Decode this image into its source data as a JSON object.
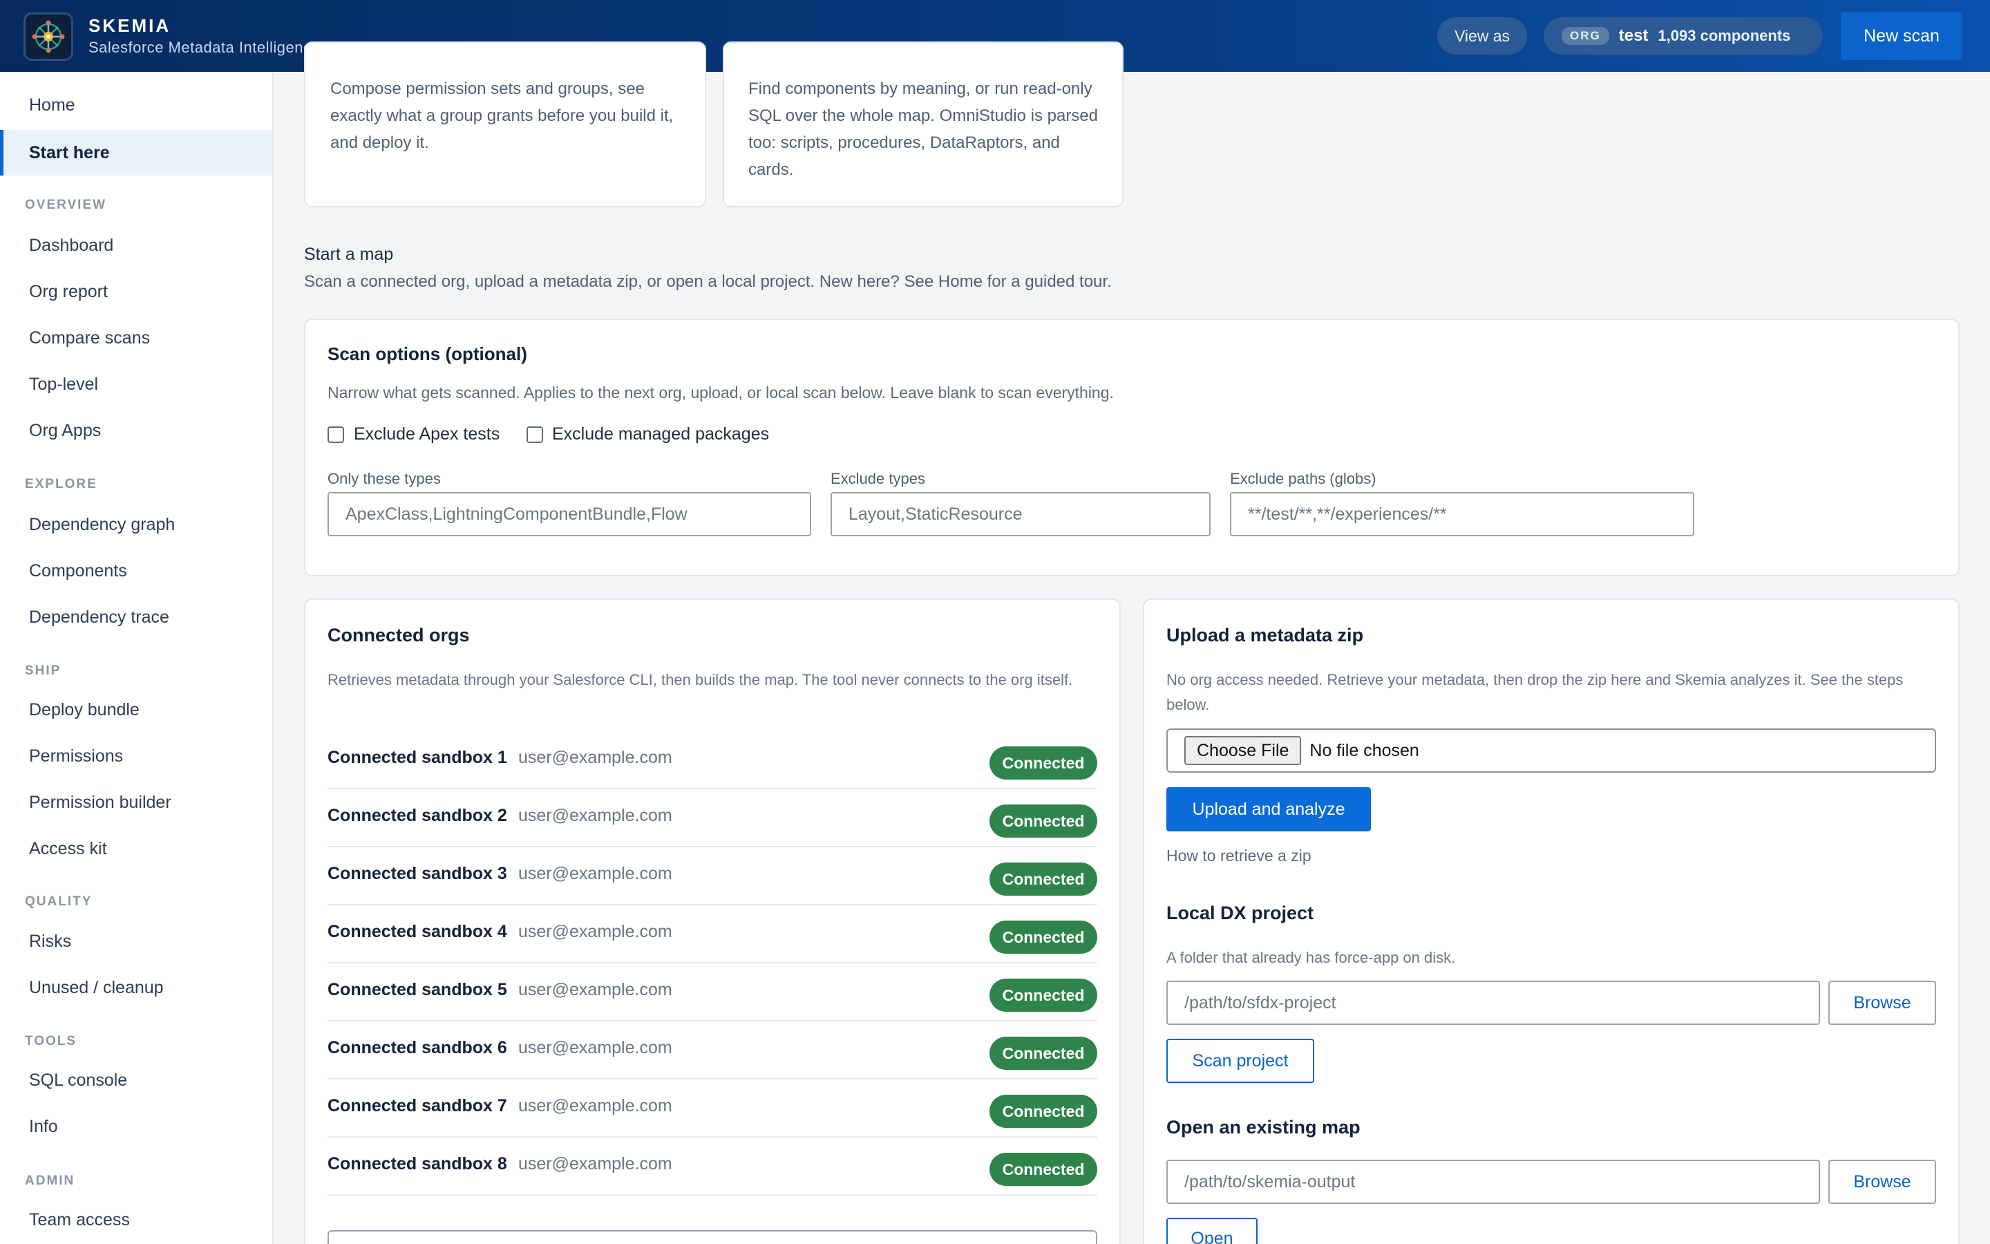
{
  "app": {
    "name": "SKEMIA",
    "tagline": "Salesforce Metadata Intelligence",
    "logo_icon": "network-compass-icon"
  },
  "header": {
    "view_as_label": "View as",
    "org_badge": "ORG",
    "org_name": "test",
    "component_count": "1,093 components",
    "new_scan_label": "New scan"
  },
  "sidebar": {
    "top_items": [
      {
        "label": "Home"
      },
      {
        "label": "Start here",
        "active": true
      }
    ],
    "sections": [
      {
        "title": "OVERVIEW",
        "items": [
          "Dashboard",
          "Org report",
          "Compare scans",
          "Top-level",
          "Org Apps"
        ]
      },
      {
        "title": "EXPLORE",
        "items": [
          "Dependency graph",
          "Components",
          "Dependency trace"
        ]
      },
      {
        "title": "SHIP",
        "items": [
          "Deploy bundle",
          "Permissions",
          "Permission builder",
          "Access kit"
        ]
      },
      {
        "title": "QUALITY",
        "items": [
          "Risks",
          "Unused / cleanup"
        ]
      },
      {
        "title": "TOOLS",
        "items": [
          "SQL console",
          "Info"
        ]
      },
      {
        "title": "ADMIN",
        "items": [
          "Team access"
        ]
      }
    ]
  },
  "features": [
    {
      "text": "Compose permission sets and groups, see exactly what a group grants before you build it, and deploy it."
    },
    {
      "text": "Find components by meaning, or run read-only SQL over the whole map. OmniStudio is parsed too: scripts, procedures, DataRaptors, and cards."
    }
  ],
  "start": {
    "title": "Start a map",
    "subtitle": "Scan a connected org, upload a metadata zip, or open a local project. New here? See Home for a guided tour."
  },
  "scan_options": {
    "title": "Scan options (optional)",
    "description": "Narrow what gets scanned. Applies to the next org, upload, or local scan below. Leave blank to scan everything.",
    "exclude_tests_label": "Exclude Apex tests",
    "exclude_tests_checked": false,
    "exclude_managed_label": "Exclude managed packages",
    "exclude_managed_checked": false,
    "only_types_label": "Only these types",
    "only_types_placeholder": "ApexClass,LightningComponentBundle,Flow",
    "exclude_types_label": "Exclude types",
    "exclude_types_placeholder": "Layout,StaticResource",
    "exclude_paths_label": "Exclude paths (globs)",
    "exclude_paths_placeholder": "**/test/**,**/experiences/**"
  },
  "connected_orgs": {
    "title": "Connected orgs",
    "description": "Retrieves metadata through your Salesforce CLI, then builds the map. The tool never connects to the org itself.",
    "status_color": "#2e844a",
    "orgs": [
      {
        "name": "Connected sandbox 1",
        "user": "user@example.com",
        "status": "Connected"
      },
      {
        "name": "Connected sandbox 2",
        "user": "user@example.com",
        "status": "Connected"
      },
      {
        "name": "Connected sandbox 3",
        "user": "user@example.com",
        "status": "Connected"
      },
      {
        "name": "Connected sandbox 4",
        "user": "user@example.com",
        "status": "Connected"
      },
      {
        "name": "Connected sandbox 5",
        "user": "user@example.com",
        "status": "Connected"
      },
      {
        "name": "Connected sandbox 6",
        "user": "user@example.com",
        "status": "Connected"
      },
      {
        "name": "Connected sandbox 7",
        "user": "user@example.com",
        "status": "Connected"
      },
      {
        "name": "Connected sandbox 8",
        "user": "user@example.com",
        "status": "Connected"
      }
    ]
  },
  "upload": {
    "title": "Upload a metadata zip",
    "description": "No org access needed. Retrieve your metadata, then drop the zip here and Skemia analyzes it. See the steps below.",
    "choose_file_label": "Choose File",
    "file_status": "No file chosen",
    "upload_button": "Upload and analyze",
    "help_link": "How to retrieve a zip"
  },
  "local_project": {
    "title": "Local DX project",
    "description": "A folder that already has force-app on disk.",
    "path_placeholder": "/path/to/sfdx-project",
    "browse_label": "Browse",
    "scan_label": "Scan project"
  },
  "existing_map": {
    "title": "Open an existing map",
    "path_placeholder": "/path/to/skemia-output",
    "browse_label": "Browse",
    "open_label": "Open"
  },
  "colors": {
    "header_start": "#062a5e",
    "header_end": "#0b52ad",
    "accent": "#0b63cc",
    "primary_button": "#0b6bdb"
  }
}
